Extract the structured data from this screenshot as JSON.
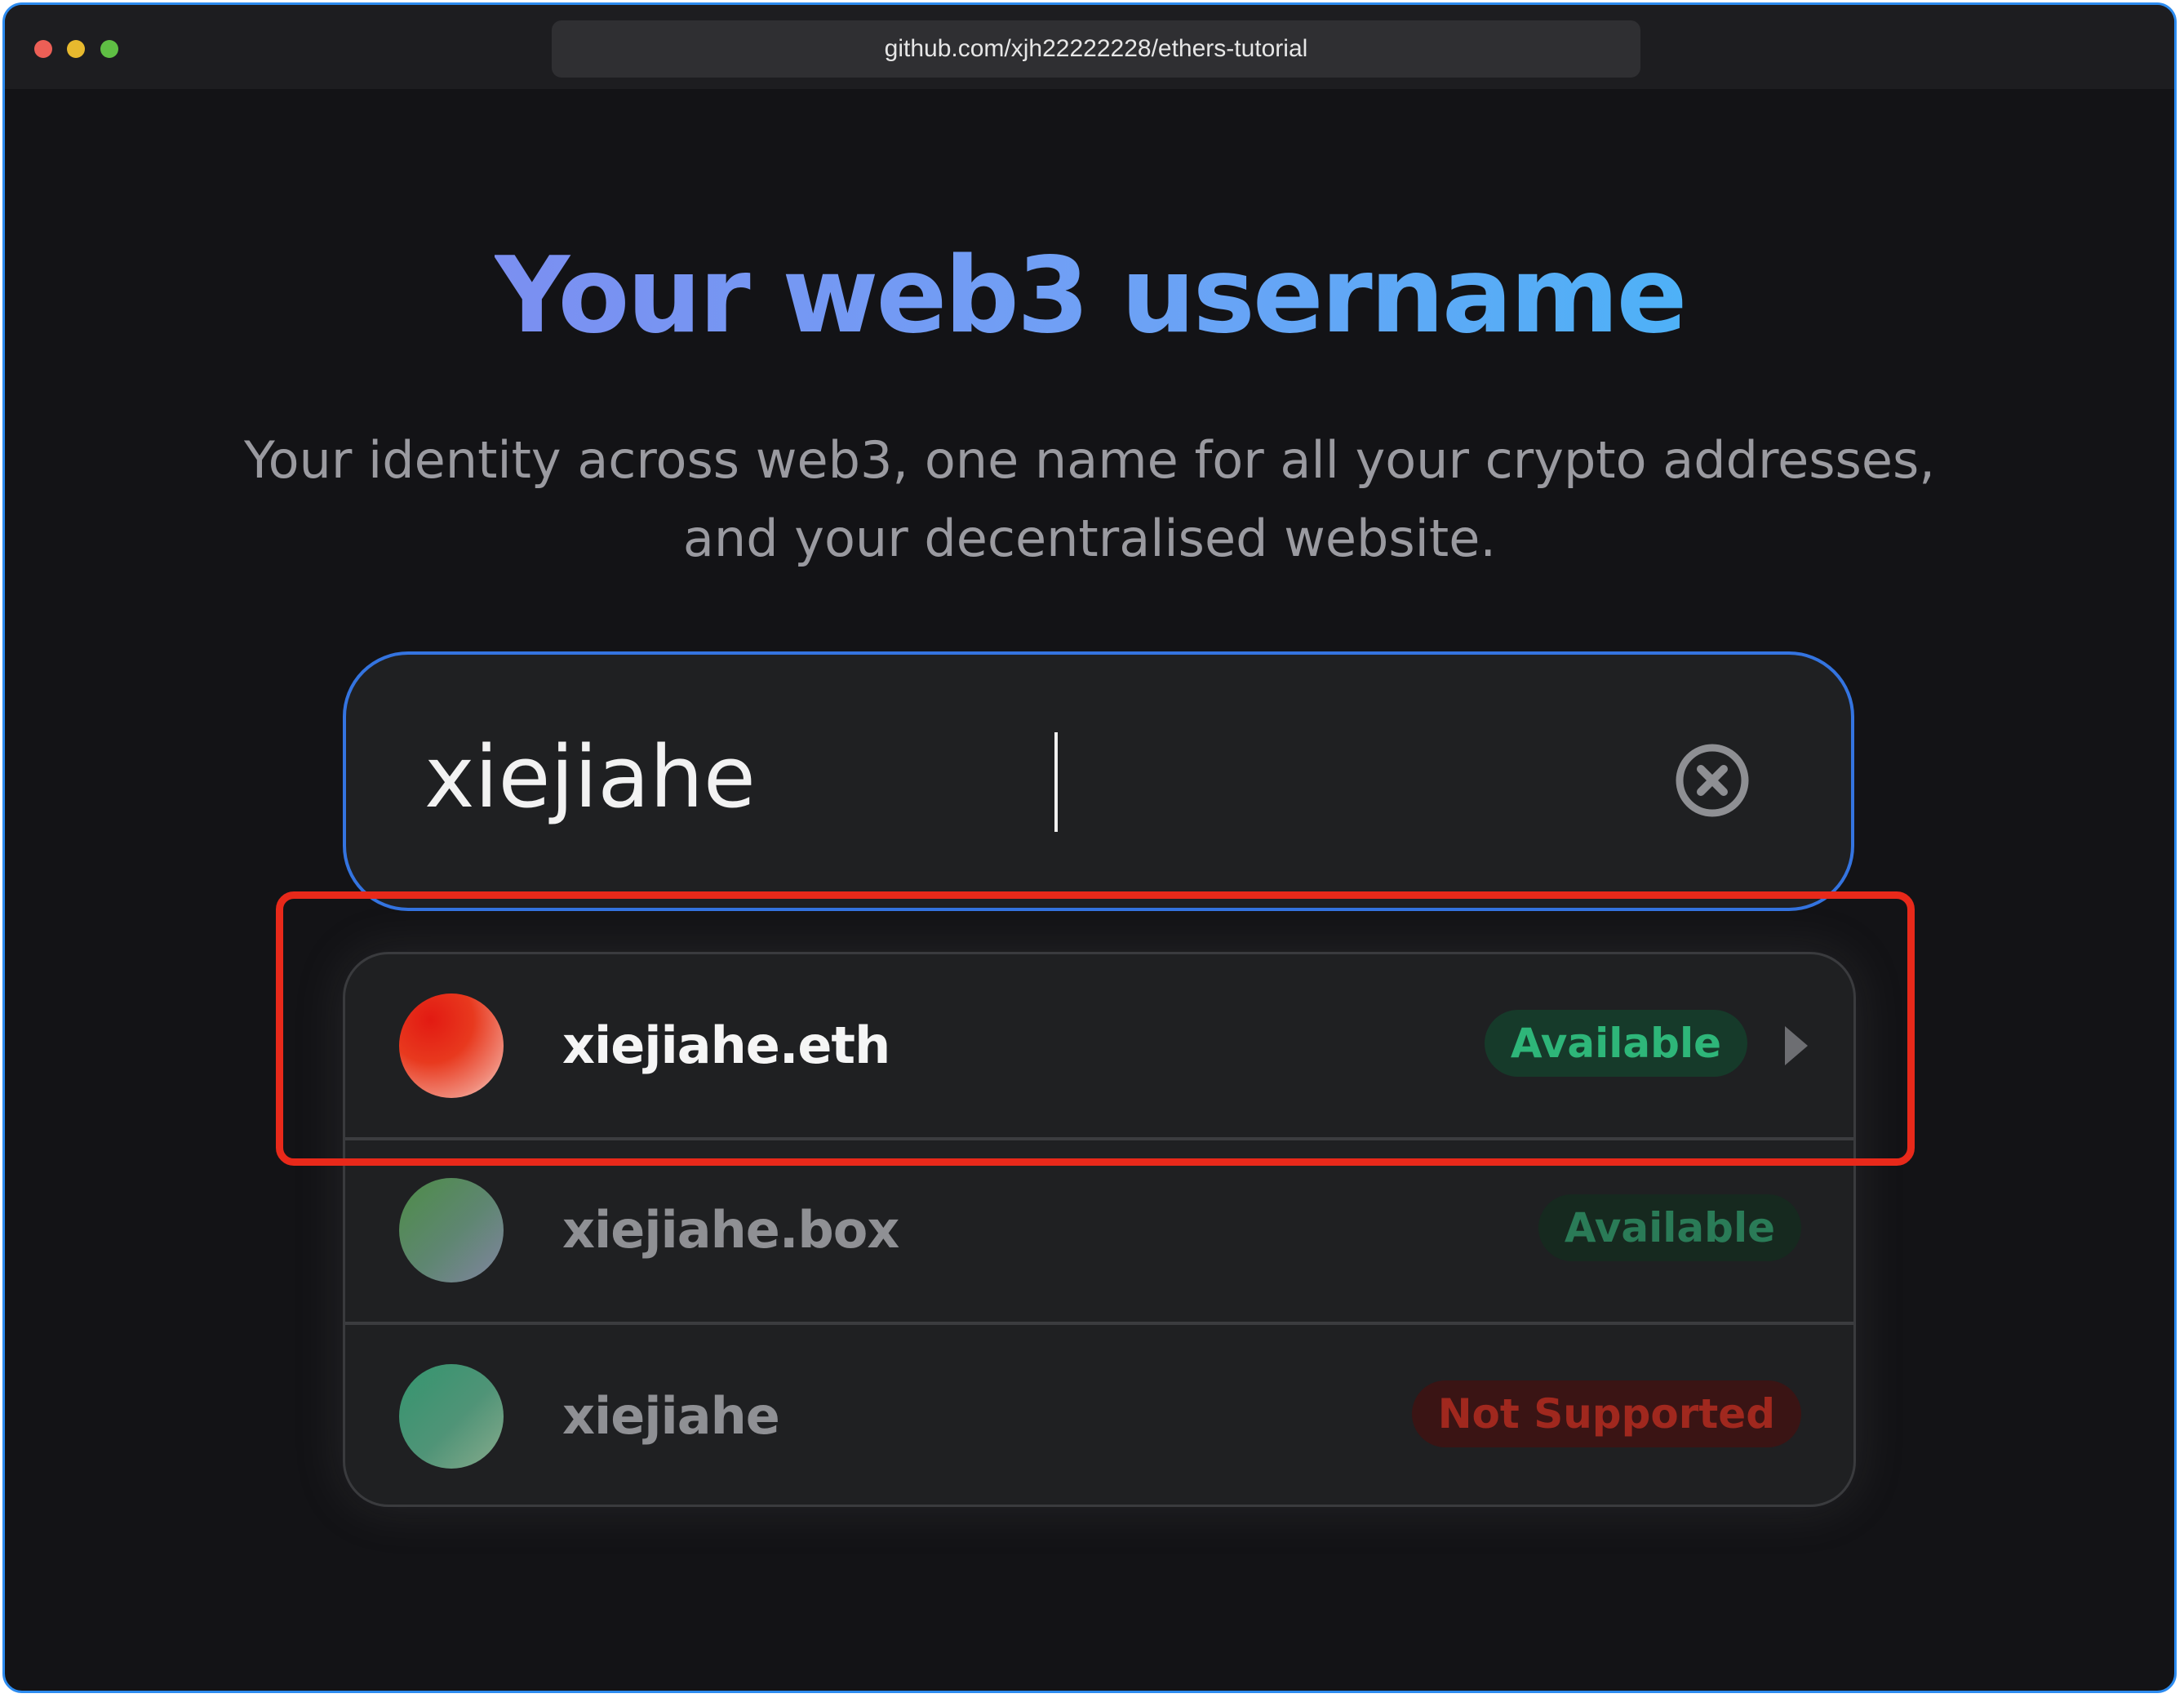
{
  "browser": {
    "url": "github.com/xjh22222228/ethers-tutorial"
  },
  "hero": {
    "title": "Your web3 username",
    "subtitle_line1": "Your identity across web3, one name for all your crypto addresses,",
    "subtitle_line2": "and your decentralised website."
  },
  "search": {
    "value": "xiejiahe",
    "clear_icon": "close-circle-icon"
  },
  "results": [
    {
      "name": "xiejiahe.eth",
      "status": "Available",
      "status_color": "#2eb679",
      "avatar_color": "#e21a12"
    },
    {
      "name": "xiejiahe.box",
      "status": "Available",
      "status_color": "#2a7b57",
      "avatar_color": "#59a851"
    },
    {
      "name": "xiejiahe",
      "status": "Not Supported",
      "status_color": "#a0281e",
      "avatar_color": "#38aa7c"
    }
  ],
  "colors": {
    "accent_border": "#3474e0",
    "highlight": "#e8291a",
    "background": "#131316"
  }
}
